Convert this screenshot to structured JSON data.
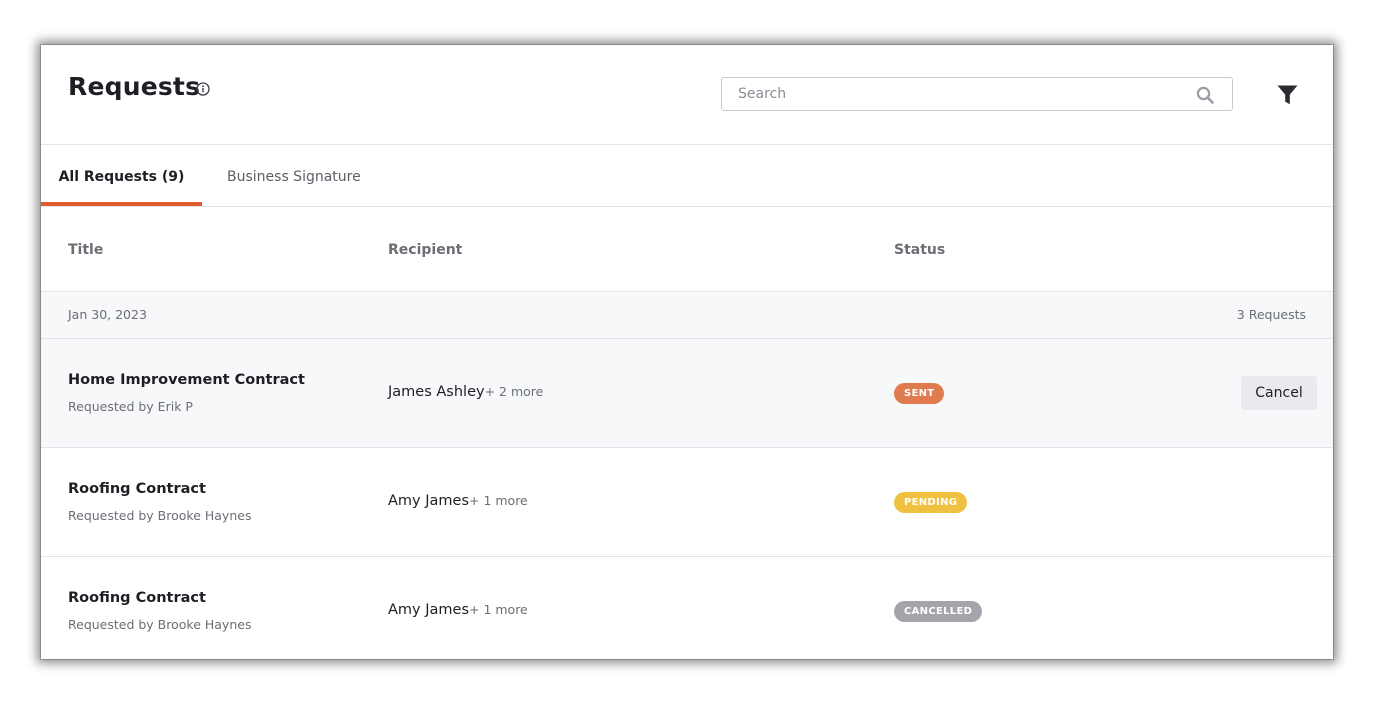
{
  "header": {
    "title": "Requests",
    "search_placeholder": "Search"
  },
  "tabs": [
    {
      "label": "All Requests (9)",
      "active": true
    },
    {
      "label": "Business Signature",
      "active": false
    }
  ],
  "columns": {
    "title": "Title",
    "recipient": "Recipient",
    "status": "Status"
  },
  "group": {
    "date": "Jan 30, 2023",
    "count": "3 Requests"
  },
  "rows": [
    {
      "title": "Home Improvement Contract",
      "requested_by": "Requested by Erik P",
      "recipient": "James Ashley",
      "recipient_more": "+ 2 more",
      "status": "SENT",
      "status_color": "#e07a4f",
      "action": "Cancel"
    },
    {
      "title": "Roofing Contract",
      "requested_by": "Requested by Brooke Haynes",
      "recipient": "Amy James",
      "recipient_more": "+ 1 more",
      "status": "PENDING",
      "status_color": "#f0c040"
    },
    {
      "title": "Roofing Contract",
      "requested_by": "Requested by Brooke Haynes",
      "recipient": "Amy James",
      "recipient_more": "+ 1 more",
      "status": "CANCELLED",
      "status_color": "#a3a5aa"
    }
  ],
  "colors": {
    "accent": "#e05a2f",
    "text": "#1d1f24",
    "muted": "#6b6e75",
    "row_highlight": "#f7f8fa"
  },
  "icons": {
    "title_info": "info-icon",
    "search": "search-icon",
    "filter": "filter-icon"
  }
}
